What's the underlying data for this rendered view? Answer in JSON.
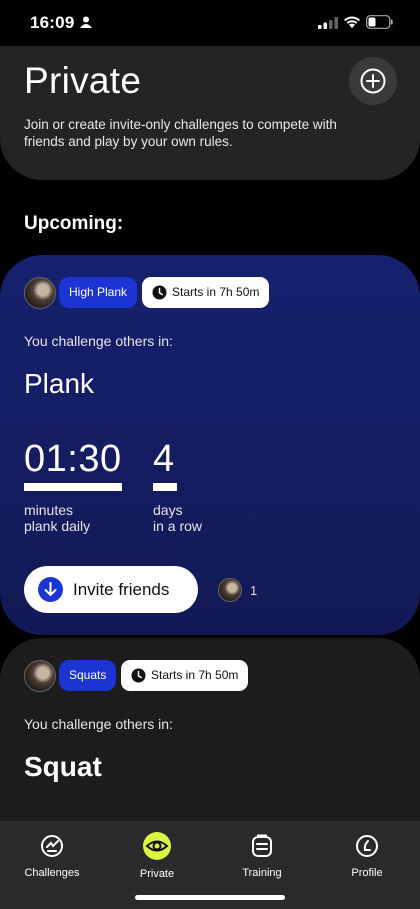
{
  "status_bar": {
    "time": "16:09"
  },
  "header": {
    "title": "Private",
    "description": "Join or create invite-only challenges to compete with friends and play by your own rules."
  },
  "section_label": "Upcoming:",
  "challenges": [
    {
      "tag": "High Plank",
      "starts": "Starts in 7h 50m",
      "intro": "You challenge others in:",
      "exercise": "Plank",
      "metric1": {
        "value": "01:30",
        "label_line1": "minutes",
        "label_line2": "plank daily"
      },
      "metric2": {
        "value": "4",
        "label_line1": "days",
        "label_line2": "in a row"
      },
      "invite_label": "Invite friends",
      "participants": "1"
    },
    {
      "tag": "Squats",
      "starts": "Starts in 7h 50m",
      "intro": "You challenge others in:",
      "exercise": "Squat"
    }
  ],
  "tabs": [
    {
      "label": "Challenges",
      "icon": "challenges-icon"
    },
    {
      "label": "Private",
      "icon": "eye-icon",
      "active": true
    },
    {
      "label": "Training",
      "icon": "clipboard-icon"
    },
    {
      "label": "Profile",
      "icon": "profile-icon"
    }
  ],
  "colors": {
    "accent_blue": "#1d34d4",
    "card_blue": "#16206e",
    "active_tab": "#dcf542"
  }
}
